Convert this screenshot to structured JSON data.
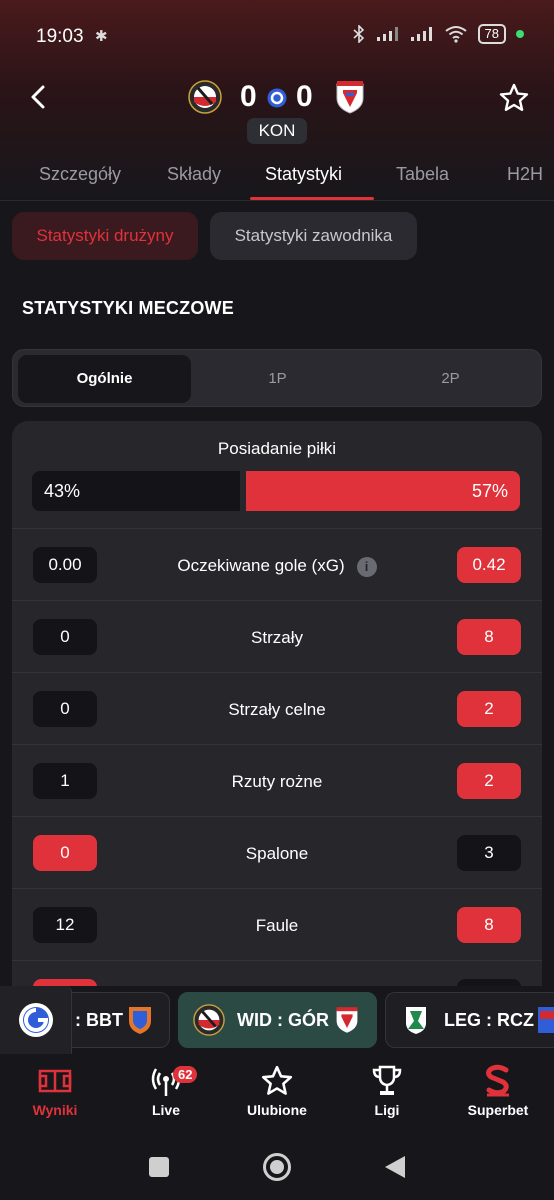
{
  "status_bar": {
    "time": "19:03",
    "battery": "78"
  },
  "match": {
    "home_score": "0",
    "away_score": "0",
    "status": "KON"
  },
  "tabs": [
    {
      "label": "Szczegóły"
    },
    {
      "label": "Składy"
    },
    {
      "label": "Statystyki"
    },
    {
      "label": "Tabela"
    },
    {
      "label": "H2H"
    }
  ],
  "sub_tabs": {
    "team": "Statystyki drużyny",
    "player": "Statystyki zawodnika"
  },
  "section_title": "STATYSTYKI MECZOWE",
  "periods": [
    {
      "label": "Ogólnie"
    },
    {
      "label": "1P"
    },
    {
      "label": "2P"
    }
  ],
  "possession": {
    "label": "Posiadanie piłki",
    "home": "43%",
    "away": "57%",
    "home_fraction": 0.43
  },
  "stats": [
    {
      "label": "Oczekiwane gole (xG)",
      "home": "0.00",
      "away": "0.42",
      "info": "i",
      "highlight": "away"
    },
    {
      "label": "Strzały",
      "home": "0",
      "away": "8",
      "highlight": "away"
    },
    {
      "label": "Strzały celne",
      "home": "0",
      "away": "2",
      "highlight": "away"
    },
    {
      "label": "Rzuty rożne",
      "home": "1",
      "away": "2",
      "highlight": "away"
    },
    {
      "label": "Spalone",
      "home": "0",
      "away": "3",
      "highlight": "home"
    },
    {
      "label": "Faule",
      "home": "12",
      "away": "8",
      "highlight": "away"
    }
  ],
  "ticker": [
    {
      "text": ": BBT"
    },
    {
      "text": "WID : GÓR"
    },
    {
      "text": "LEG : RCZ"
    }
  ],
  "bottom_nav": {
    "results": "Wyniki",
    "live": "Live",
    "live_badge": "62",
    "favorites": "Ulubione",
    "leagues": "Ligi",
    "superbet": "Superbet"
  },
  "colors": {
    "accent": "#e0323b",
    "background": "#17171b",
    "card": "#26262b",
    "active_ticker": "#2b4a44"
  }
}
